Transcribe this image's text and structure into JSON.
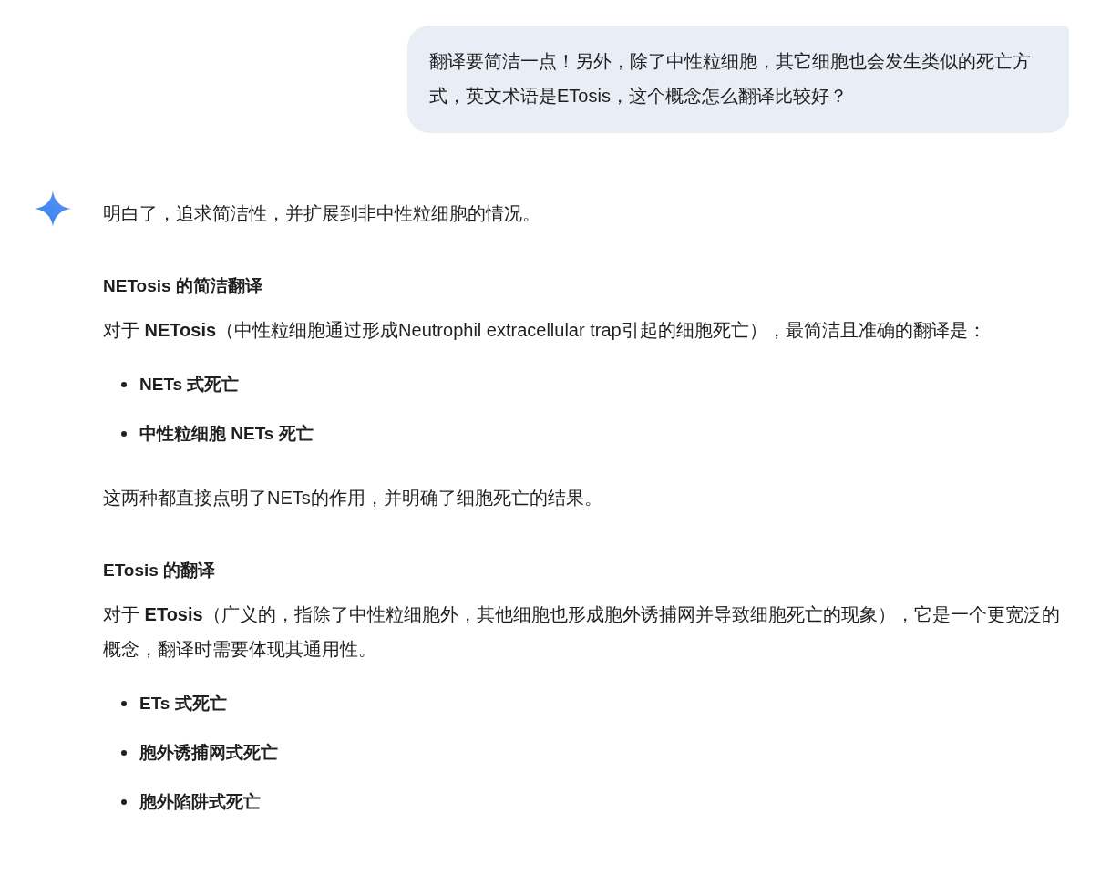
{
  "user_message": {
    "text": "翻译要简洁一点！另外，除了中性粒细胞，其它细胞也会发生类似的死亡方式，英文术语是ETosis，这个概念怎么翻译比较好？"
  },
  "response": {
    "blocks": [
      {
        "kind": "paragraph",
        "text": "明白了，追求简洁性，并扩展到非中性粒细胞的情况。"
      },
      {
        "kind": "heading",
        "text": "NETosis 的简洁翻译"
      },
      {
        "kind": "paragraph",
        "text": "对于 **NETosis**（中性粒细胞通过形成Neutrophil extracellular trap引起的细胞死亡），最简洁且准确的翻译是："
      },
      {
        "kind": "list",
        "items": [
          "NETs 式死亡",
          "中性粒细胞 NETs 死亡"
        ]
      },
      {
        "kind": "paragraph",
        "text": "这两种都直接点明了NETs的作用，并明确了细胞死亡的结果。"
      },
      {
        "kind": "heading",
        "text": "ETosis 的翻译"
      },
      {
        "kind": "paragraph",
        "text": "对于 **ETosis**（广义的，指除了中性粒细胞外，其他细胞也形成胞外诱捕网并导致细胞死亡的现象），它是一个更宽泛的概念，翻译时需要体现其通用性。"
      },
      {
        "kind": "list",
        "items": [
          "ETs 式死亡",
          "胞外诱捕网式死亡",
          "胞外陷阱式死亡"
        ]
      }
    ]
  }
}
